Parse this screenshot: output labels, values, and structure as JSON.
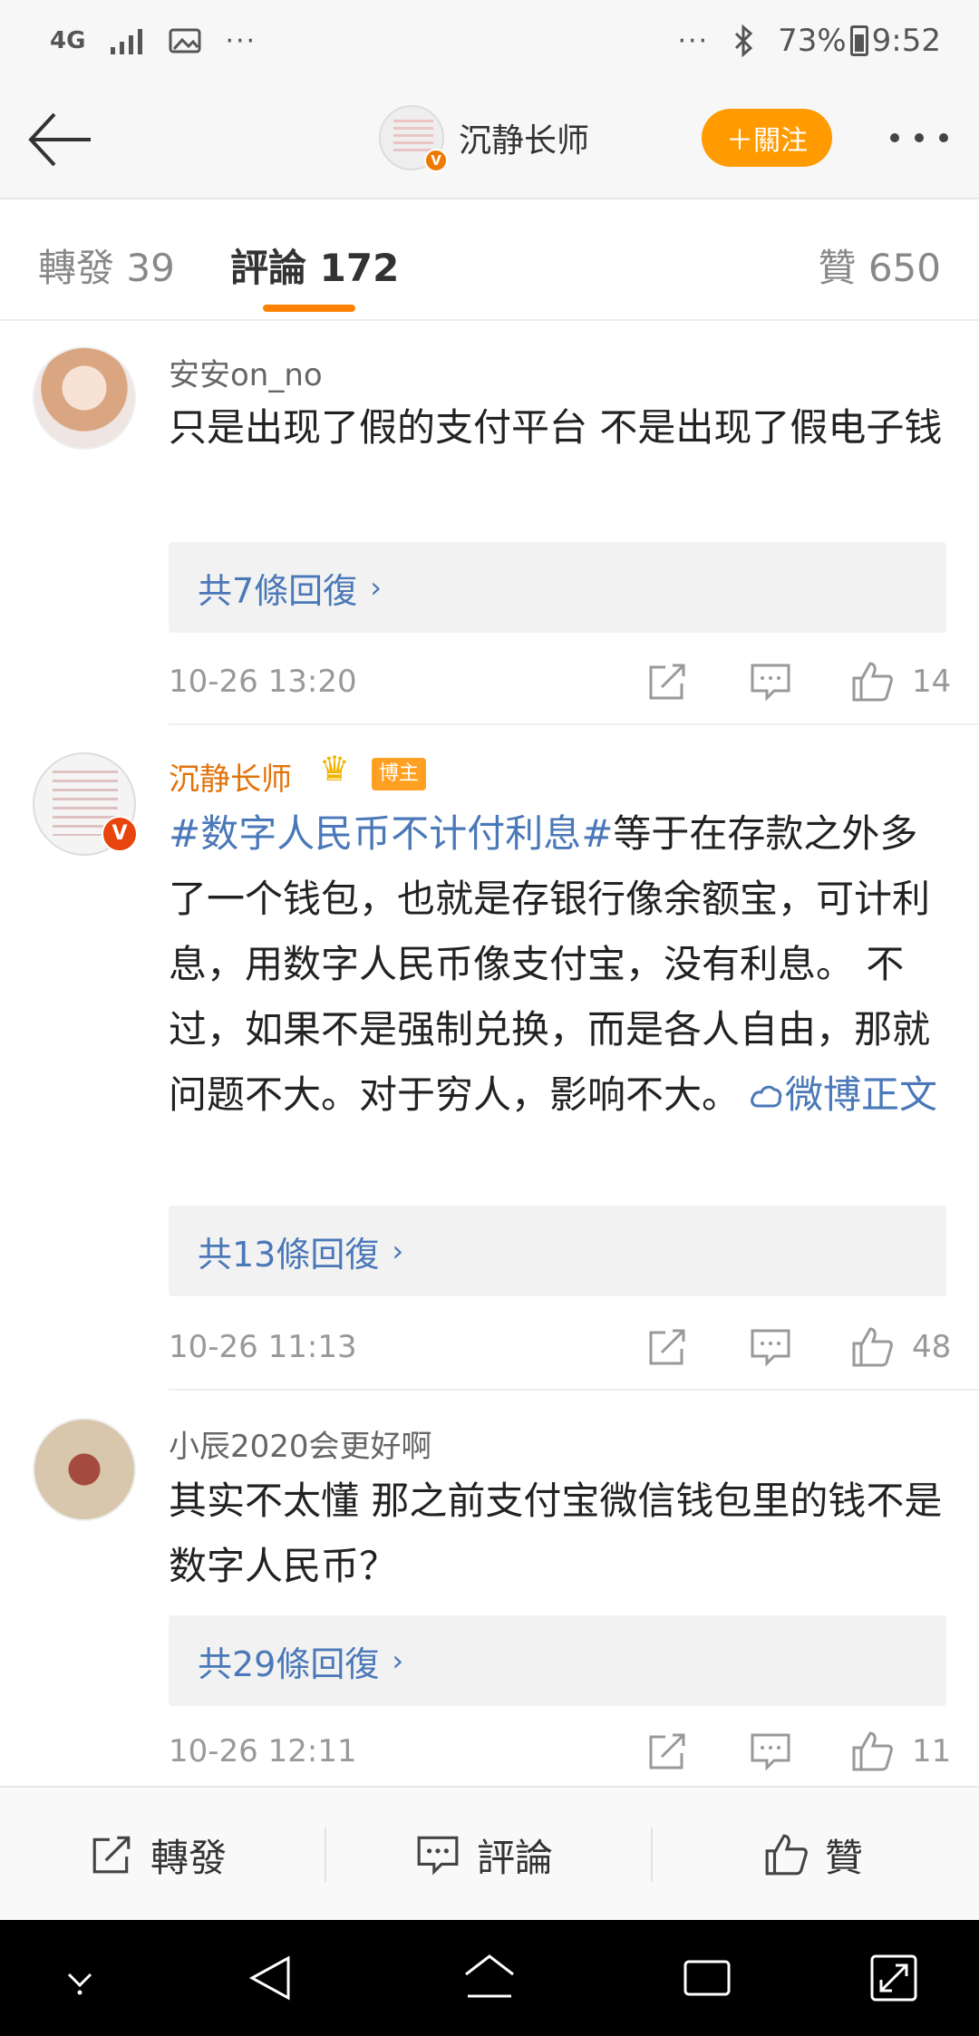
{
  "status_bar": {
    "network": "4G",
    "more_left": "···",
    "more_right": "···",
    "battery": "73%",
    "time": "9:52"
  },
  "header": {
    "name": "沉静长师",
    "follow_label": "＋關注",
    "verified": "V"
  },
  "tabs": {
    "repost": "轉發 39",
    "comments": "評論 172",
    "likes": "贊 650"
  },
  "comments": [
    {
      "name": "安安on_no",
      "text": "只是出现了假的支付平台 不是出现了假电子钱",
      "replies": "共7條回復",
      "time": "10-26 13:20",
      "likes": "14"
    },
    {
      "name": "沉静长师",
      "blogger_tag": "博主",
      "hashtag": "#数字人民币不计付利息#",
      "text": "等于在存款之外多了一个钱包，也就是存银行像余额宝，可计利息，用数字人民币像支付宝，没有利息。 不过，如果不是强制兑换，而是各人自由，那就问题不大。对于穷人，影响不大。",
      "link": "微博正文",
      "replies": "共13條回復",
      "time": "10-26 11:13",
      "likes": "48"
    },
    {
      "name": "小辰2020会更好啊",
      "text": "其实不太懂 那之前支付宝微信钱包里的钱不是数字人民币？",
      "replies": "共29條回復",
      "time": "10-26 12:11",
      "likes": "11"
    }
  ],
  "action_bar": {
    "repost": "轉發",
    "comment": "評論",
    "like": "贊"
  },
  "colors": {
    "accent": "#ff8200",
    "link": "#4a78b8",
    "blogger_name": "#e2730b"
  }
}
